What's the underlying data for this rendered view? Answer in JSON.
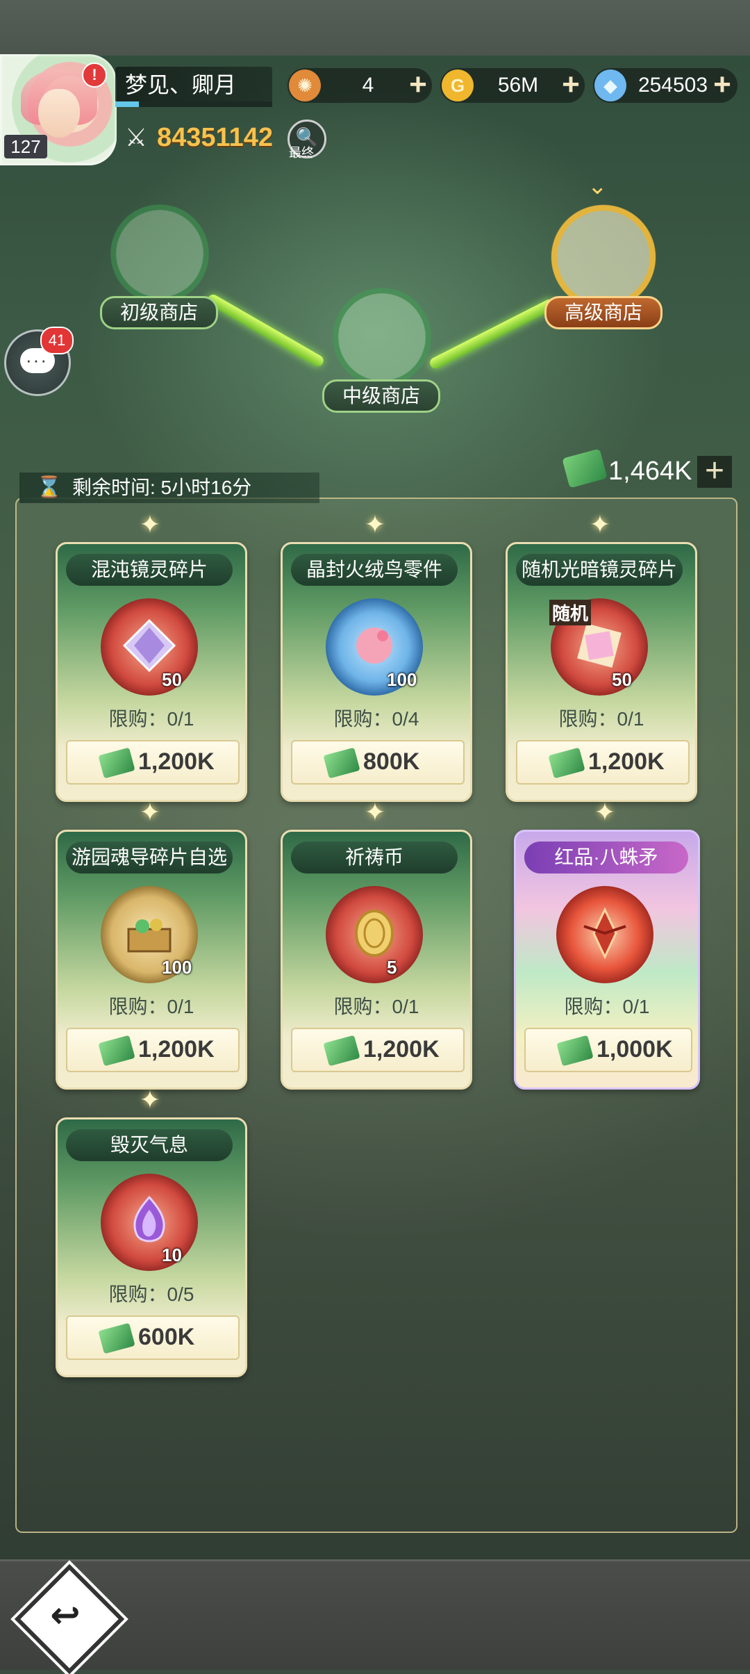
{
  "player": {
    "name": "梦见、卿月",
    "level": "127",
    "alert": "!",
    "power": "84351142",
    "search_caption": "最终",
    "xp_fraction": 0.15
  },
  "currencies": [
    {
      "icon": "energy-icon",
      "value": "4",
      "color": "#e08a3a"
    },
    {
      "icon": "gold-coin-icon",
      "value": "56M",
      "color": "#f0b62e"
    },
    {
      "icon": "diamond-icon",
      "value": "254503",
      "color": "#6fb8f0"
    }
  ],
  "shop_tiers": [
    {
      "label": "初级商店",
      "active": false
    },
    {
      "label": "中级商店",
      "active": false
    },
    {
      "label": "高级商店",
      "active": true
    }
  ],
  "chat": {
    "count": "41"
  },
  "timer": {
    "text": "剩余时间: 5小时16分"
  },
  "ticket_balance": "1,464K",
  "items": [
    {
      "name": "混沌镜灵碎片",
      "qty": "50",
      "limit": "限购：0/1",
      "price": "1,200K",
      "icon": "prism-crystal-icon",
      "rare": false,
      "random": ""
    },
    {
      "name": "晶封火绒鸟零件",
      "qty": "100",
      "limit": "限购：0/4",
      "price": "800K",
      "icon": "flamingo-orb-icon",
      "rare": false,
      "random": ""
    },
    {
      "name": "随机光暗镜灵碎片",
      "qty": "50",
      "limit": "限购：0/1",
      "price": "1,200K",
      "icon": "light-dark-prism-icon",
      "rare": false,
      "random": "随机"
    },
    {
      "name": "游园魂导碎片自选",
      "qty": "100",
      "limit": "限购：0/1",
      "price": "1,200K",
      "icon": "treasure-box-icon",
      "rare": false,
      "random": ""
    },
    {
      "name": "祈祷币",
      "qty": "5",
      "limit": "限购：0/1",
      "price": "1,200K",
      "icon": "prayer-coin-icon",
      "rare": false,
      "random": ""
    },
    {
      "name": "红品·八蛛矛",
      "qty": "",
      "limit": "限购：0/1",
      "price": "1,000K",
      "icon": "spider-spear-icon",
      "rare": true,
      "random": ""
    },
    {
      "name": "毁灭气息",
      "qty": "10",
      "limit": "限购：0/5",
      "price": "600K",
      "icon": "purple-flame-gem-icon",
      "rare": false,
      "random": ""
    }
  ],
  "colors": {
    "accent_gold": "#f7c24d",
    "active_tab": "#c0692e",
    "panel_green": "#2f6a47"
  }
}
